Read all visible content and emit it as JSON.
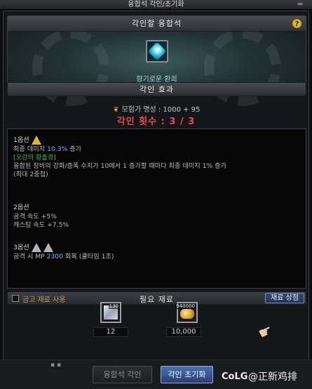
{
  "window": {
    "title": "융합석 각인/초기화"
  },
  "header": {
    "title": "각인할 융합석",
    "help_label": "?",
    "item_name": "향기로운 환희"
  },
  "effect": {
    "section_title": "각인 효과",
    "fame_text": "모험가 명성 : 1000 + 95",
    "count_text": "각인 횟수 : 3 / 3"
  },
  "options": {
    "opt1": {
      "title": "1옵션",
      "line1_prefix": "최종 데미지 ",
      "line1_value": "10.3%",
      "line1_suffix": " 증가",
      "set_name": "[오감의 황홀경]",
      "line3": "융합된 장비의 강화/증폭 수치가 10에서 1 증가할 때마다 최종 데미지 1% 증가",
      "line4": "(최대 2중첩)"
    },
    "opt2": {
      "title": "2옵션",
      "line1": "공격 속도 +5%",
      "line2": "캐스팅 속도 +7.5%"
    },
    "opt3": {
      "title": "3옵션",
      "line1_prefix": "공격 시 MP ",
      "line1_value": "2300",
      "line1_suffix": " 회복 (쿨타임 1초)"
    }
  },
  "materials": {
    "use_gold_label": "금고 재료 사용",
    "title": "필요 재료",
    "shop_label": "재료 상점",
    "item1": {
      "badge": "130",
      "count": "12"
    },
    "item2": {
      "badge": "940000",
      "count": "10,000"
    }
  },
  "buttons": {
    "engrave": "융합석 각인",
    "reset": "각인 초기화"
  },
  "watermark": {
    "brand": "CoLG",
    "user": "@正新鸡排"
  },
  "colors": {
    "accent_red": "#e74a4a",
    "accent_blue": "#7fb0ff",
    "set_green": "#3fb24d",
    "gold": "#e2b533"
  }
}
